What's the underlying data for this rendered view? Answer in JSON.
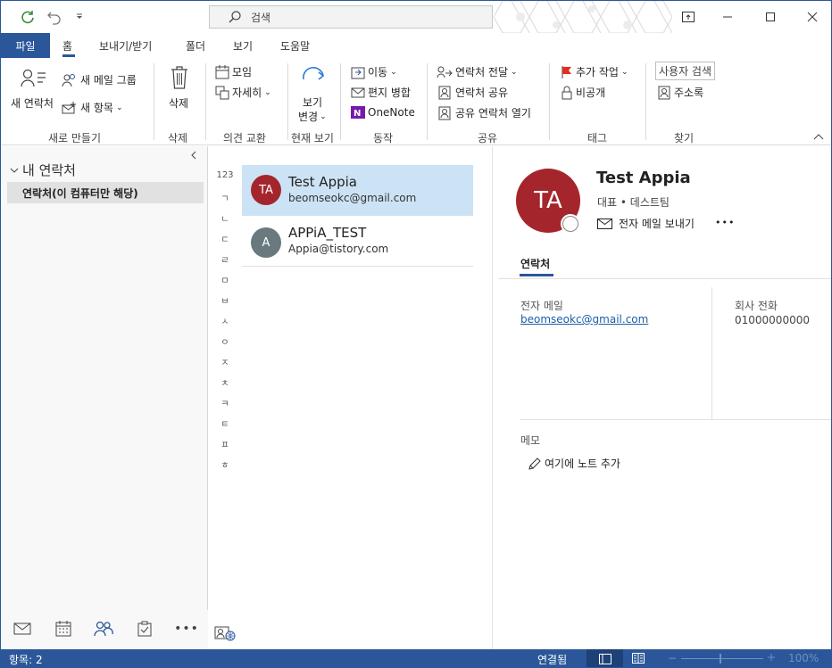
{
  "search": {
    "placeholder": "검색"
  },
  "tabs": {
    "file": "파일",
    "home": "홈",
    "send_receive": "보내기/받기",
    "folder": "폴더",
    "view": "보기",
    "help": "도움말"
  },
  "ribbon": {
    "new_contact": "새 연락처",
    "new_group": "새 메일 그룹",
    "new_items": "새 항목",
    "group_new": "새로 만들기",
    "delete": "삭제",
    "group_delete": "삭제",
    "meeting": "모임",
    "more": "자세히",
    "group_comm": "의견 교환",
    "change_view_1": "보기",
    "change_view_2": "변경",
    "group_view": "현재 보기",
    "move": "이동",
    "mail_merge": "편지 병합",
    "onenote": "OneNote",
    "group_actions": "동작",
    "forward_contact": "연락처 전달",
    "share_contacts": "연락처 공유",
    "open_shared": "공유 연락처 열기",
    "group_share": "공유",
    "follow_up": "추가 작업",
    "private": "비공개",
    "group_tags": "태그",
    "search_people": "사용자 검색",
    "address_book": "주소록",
    "group_find": "찾기"
  },
  "folders": {
    "header": "내 연락처",
    "items": [
      {
        "label": "연락처(이 컴퓨터만 해당)"
      }
    ]
  },
  "alphabet": [
    "123",
    "ㄱ",
    "ㄴ",
    "ㄷ",
    "ㄹ",
    "ㅁ",
    "ㅂ",
    "ㅅ",
    "ㅇ",
    "ㅈ",
    "ㅊ",
    "ㅋ",
    "ㅌ",
    "ㅍ",
    "ㅎ"
  ],
  "contacts": [
    {
      "initials": "TA",
      "name": "Test Appia",
      "email": "beomseokc@gmail.com",
      "avatar_color": "#a4262c"
    },
    {
      "initials": "A",
      "name": "APPiA_TEST",
      "email": "Appia@tistory.com",
      "avatar_color": "#69797e"
    }
  ],
  "detail": {
    "initials": "TA",
    "name": "Test Appia",
    "subtitle": "대표 • 데스트팀",
    "send_email": "전자 메일 보내기",
    "more": "•••",
    "tab": "연락처",
    "email_label": "전자 메일",
    "email_value": "beomseokc@gmail.com",
    "phone_label": "회사 전화",
    "phone_value": "01000000000",
    "memo_label": "메모",
    "add_note": "여기에 노트 추가"
  },
  "status": {
    "items": "항목: 2",
    "connected": "연결됨",
    "zoom": "100%"
  },
  "colors": {
    "accent": "#2b579a",
    "selected": "#cce3f5",
    "avatar_red": "#a4262c",
    "avatar_gray": "#69797e",
    "link": "#1b5fa8"
  }
}
